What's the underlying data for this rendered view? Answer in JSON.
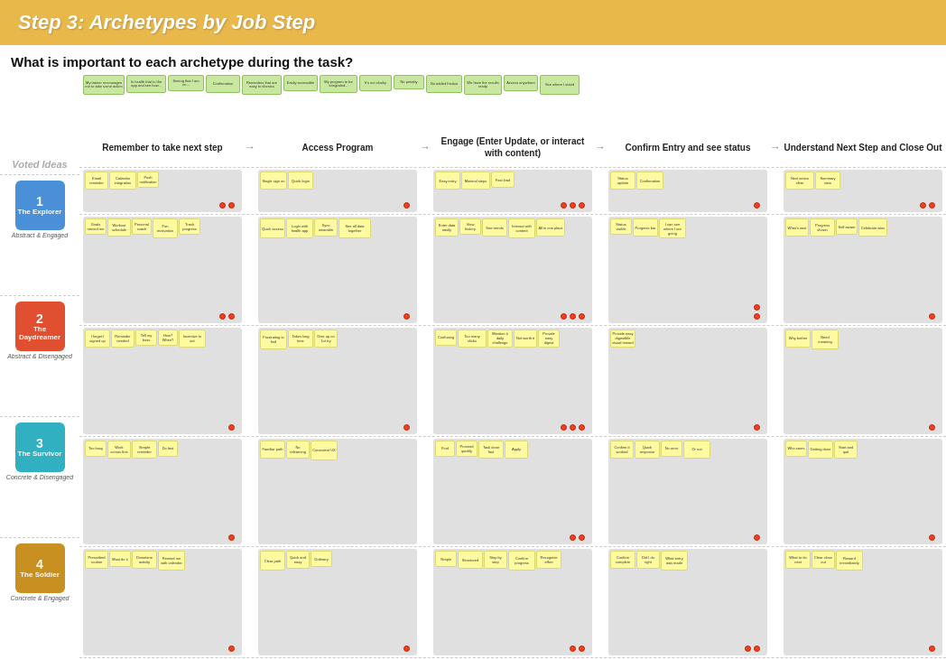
{
  "header": {
    "title": "Step 3: Archetypes by Job Step",
    "subtitle": "What is important to each archetype during the task?"
  },
  "steps": [
    {
      "label": "Remember to take next step"
    },
    {
      "label": "Access Program"
    },
    {
      "label": "Engage (Enter Update, or interact with content)"
    },
    {
      "label": "Confirm Entry and see status"
    },
    {
      "label": "Understand Next Step and Close Out"
    }
  ],
  "archetypes": [
    {
      "num": "1",
      "name": "The Explorer",
      "sub": "Abstract & Engaged",
      "color": "#4A90D9"
    },
    {
      "num": "2",
      "name": "The Daydreamer",
      "sub": "Abstract & Disengaged",
      "color": "#E05030"
    },
    {
      "num": "3",
      "name": "The Survivor",
      "sub": "Concrete & Disengaged",
      "color": "#30B0C0"
    },
    {
      "num": "4",
      "name": "The Soldier",
      "sub": "Concrete & Engaged",
      "color": "#C89020"
    }
  ],
  "voted_label": "Voted Ideas",
  "arrow_symbol": "→"
}
